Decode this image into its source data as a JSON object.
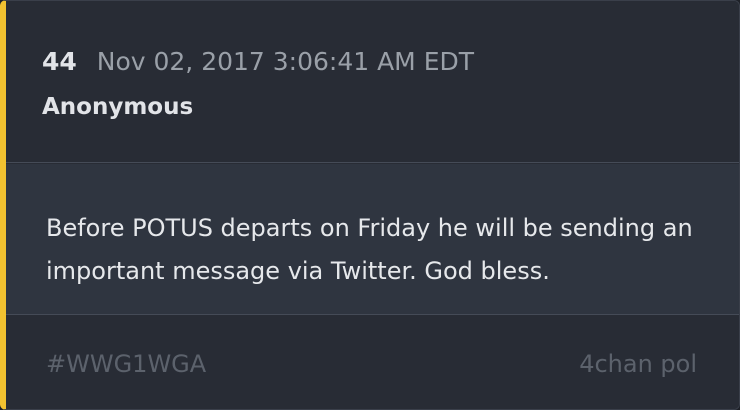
{
  "post": {
    "number": "44",
    "timestamp": "Nov 02, 2017 3:06:41 AM EDT",
    "author": "Anonymous",
    "text": "Before POTUS departs on Friday he will be sending an important message via Twitter. God bless.",
    "tag": "#WWG1WGA",
    "source": "4chan pol"
  },
  "colors": {
    "accent": "#f2c230",
    "card_background": "#282c35",
    "body_background": "#2f3540",
    "muted_text": "#5c626c"
  }
}
